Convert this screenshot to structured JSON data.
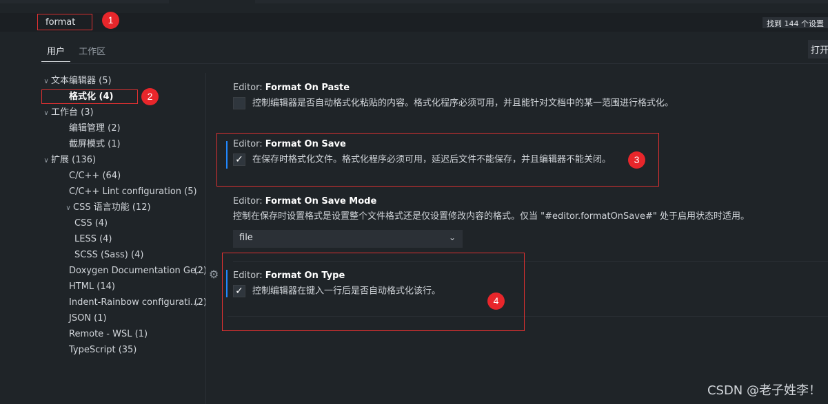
{
  "search": {
    "value": "format",
    "results": "找到 144 个设置"
  },
  "scope_tabs": {
    "user": "用户",
    "workspace": "工作区"
  },
  "open_json": "打开设置",
  "toc": [
    {
      "label": "文本编辑器 (5)",
      "level": 0,
      "chevron": "down"
    },
    {
      "label": "格式化 (4)",
      "level": 1,
      "selected": true
    },
    {
      "label": "工作台 (3)",
      "level": 0,
      "chevron": "down"
    },
    {
      "label": "编辑管理 (2)",
      "level": 1
    },
    {
      "label": "截屏模式 (1)",
      "level": 1
    },
    {
      "label": "扩展 (136)",
      "level": 0,
      "chevron": "down"
    },
    {
      "label": "C/C++ (64)",
      "level": 1
    },
    {
      "label": "C/C++ Lint configuration (5)",
      "level": 1
    },
    {
      "label": "CSS 语言功能 (12)",
      "level": 1,
      "chevron": "down"
    },
    {
      "label": "CSS (4)",
      "level": 2
    },
    {
      "label": "LESS (4)",
      "level": 2
    },
    {
      "label": "SCSS (Sass) (4)",
      "level": 2
    },
    {
      "label": "Doxygen Documentation Ge...",
      "level": 1,
      "count": "(2)"
    },
    {
      "label": "HTML (14)",
      "level": 1
    },
    {
      "label": "Indent-Rainbow configurati...",
      "level": 1,
      "count": "(2)"
    },
    {
      "label": "JSON (1)",
      "level": 1
    },
    {
      "label": "Remote - WSL (1)",
      "level": 1
    },
    {
      "label": "TypeScript (35)",
      "level": 1
    }
  ],
  "settings": {
    "format_on_paste": {
      "category": "Editor: ",
      "name": "Format On Paste",
      "description": "控制编辑器是否自动格式化粘贴的内容。格式化程序必须可用，并且能针对文档中的某一范围进行格式化。",
      "checked": false
    },
    "format_on_save": {
      "category": "Editor: ",
      "name": "Format On Save",
      "description": "在保存时格式化文件。格式化程序必须可用，延迟后文件不能保存，并且编辑器不能关闭。",
      "checked": true
    },
    "format_on_save_mode": {
      "category": "Editor: ",
      "name": "Format On Save Mode",
      "description": "控制在保存时设置格式是设置整个文件格式还是仅设置修改内容的格式。仅当 \"#editor.formatOnSave#\" 处于启用状态时适用。",
      "selected_option": "file"
    },
    "format_on_type": {
      "category": "Editor: ",
      "name": "Format On Type",
      "description": "控制编辑器在键入一行后是否自动格式化该行。",
      "checked": true
    }
  },
  "markers": [
    "1",
    "2",
    "3",
    "4"
  ],
  "check_glyph": "✓",
  "watermark": "CSDN @老子姓李！",
  "colors": {
    "accent": "#2188ff",
    "annotation": "#e03131",
    "background": "#1f2428"
  }
}
